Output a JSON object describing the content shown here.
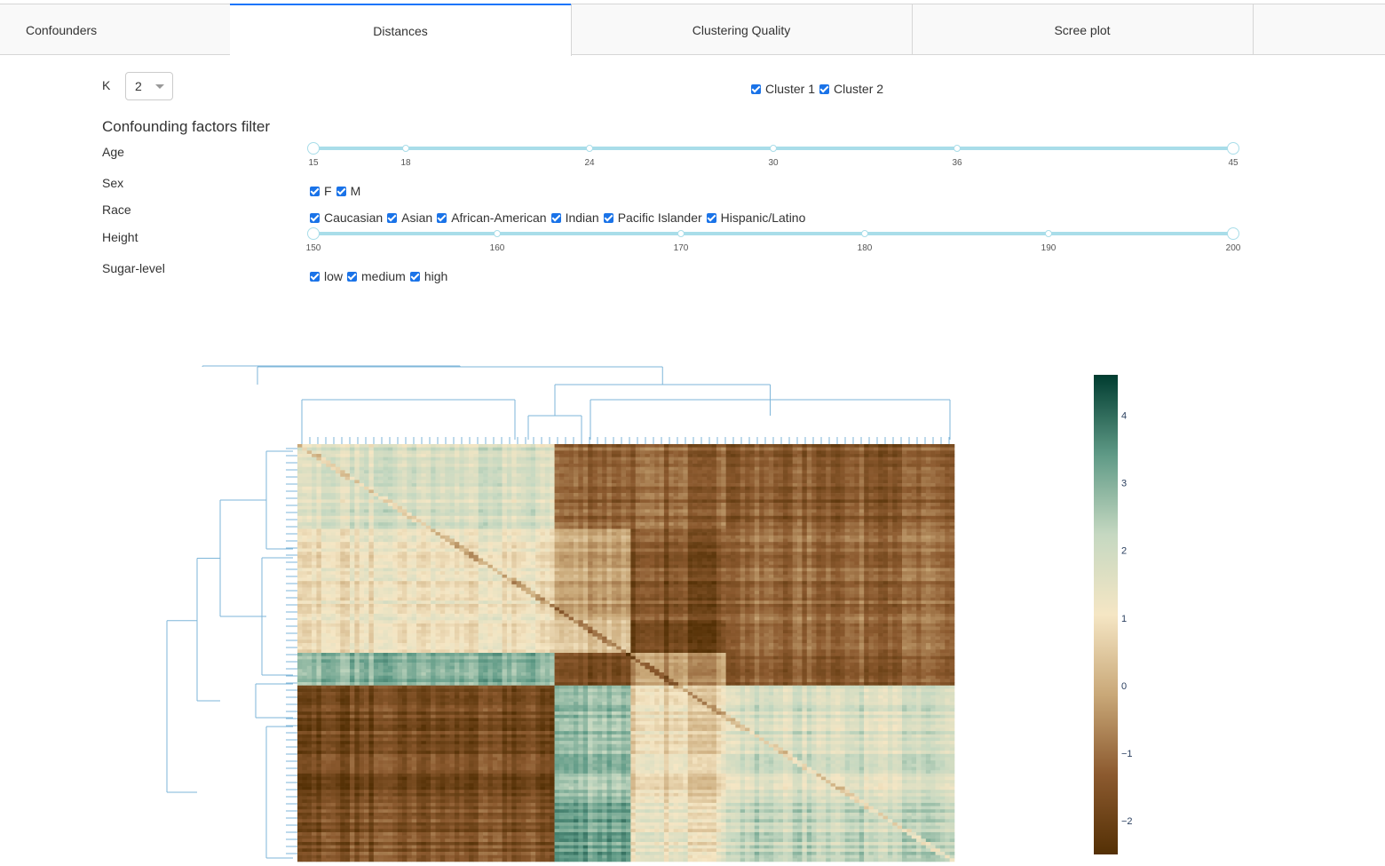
{
  "tabs": [
    {
      "label": "Confounders",
      "active": false
    },
    {
      "label": "Distances",
      "active": true
    },
    {
      "label": "Clustering Quality",
      "active": false
    },
    {
      "label": "Scree plot",
      "active": false
    }
  ],
  "k": {
    "label": "K",
    "value": "2"
  },
  "clusters": [
    "Cluster 1",
    "Cluster 2"
  ],
  "filter": {
    "heading": "Confounding factors filter",
    "age": {
      "label": "Age",
      "ticks": [
        "15",
        "18",
        "24",
        "30",
        "36",
        "45"
      ],
      "min": 15,
      "max": 45,
      "range": [
        15,
        45
      ]
    },
    "sex": {
      "label": "Sex",
      "options": [
        "F",
        "M"
      ]
    },
    "race": {
      "label": "Race",
      "options": [
        "Caucasian",
        "Asian",
        "African-American",
        "Indian",
        "Pacific Islander",
        "Hispanic/Latino"
      ]
    },
    "height": {
      "label": "Height",
      "ticks": [
        "150",
        "160",
        "170",
        "180",
        "190",
        "200"
      ],
      "min": 150,
      "max": 200,
      "range": [
        150,
        200
      ]
    },
    "sugar": {
      "label": "Sugar-level",
      "options": [
        "low",
        "medium",
        "high"
      ]
    }
  },
  "chart_data": {
    "type": "heatmap",
    "title": "",
    "colorscale": [
      "#543005",
      "#8c5a2f",
      "#c9a878",
      "#f5e6c4",
      "#c5d8c1",
      "#5f9a86",
      "#003c30"
    ],
    "zlim": [
      -2.5,
      4.6
    ],
    "colorbar_ticks": [
      "4",
      "3",
      "2",
      "1",
      "0",
      "−1",
      "−2"
    ],
    "colorbar_tick_values": [
      4,
      3,
      2,
      1,
      0,
      -1,
      -2
    ],
    "blocks_rows": [
      {
        "id": "r1",
        "size": 26
      },
      {
        "id": "r2",
        "size": 28
      },
      {
        "id": "r3",
        "size": 10
      },
      {
        "id": "r4",
        "size": 10
      },
      {
        "id": "r5",
        "size": 36
      },
      {
        "id": "r6",
        "size": 18
      }
    ],
    "blocks_cols": [
      {
        "id": "c1",
        "size": 54
      },
      {
        "id": "c2",
        "size": 16
      },
      {
        "id": "c3",
        "size": 20
      },
      {
        "id": "c4",
        "size": 48
      }
    ],
    "block_values": [
      [
        1.7,
        -1.2,
        -1.2,
        -1.4
      ],
      [
        1.0,
        -0.2,
        -1.6,
        -1.1
      ],
      [
        1.0,
        0.5,
        -1.9,
        -1.0
      ],
      [
        2.8,
        -1.8,
        -0.5,
        -1.5
      ],
      [
        -1.8,
        2.8,
        0.8,
        1.8
      ],
      [
        -1.6,
        3.3,
        1.2,
        2.2
      ]
    ],
    "diagonal_blocks": true
  }
}
